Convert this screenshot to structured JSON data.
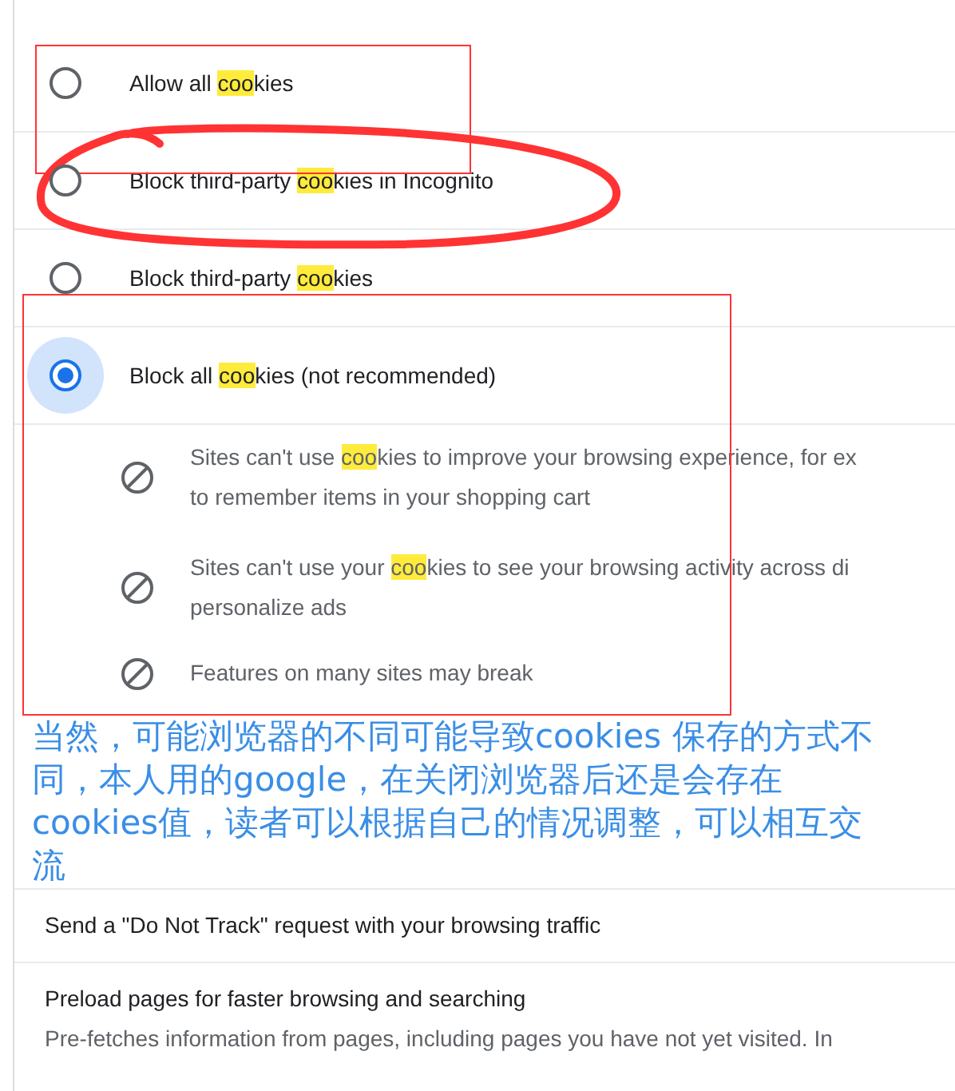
{
  "cookie_options": [
    {
      "selected": false,
      "parts": [
        {
          "text": "Allow all ",
          "highlighted": false
        },
        {
          "text": "coo",
          "highlighted": true
        },
        {
          "text": "kies",
          "highlighted": false
        }
      ]
    },
    {
      "selected": false,
      "parts": [
        {
          "text": "Block third-party ",
          "highlighted": false
        },
        {
          "text": "coo",
          "highlighted": true
        },
        {
          "text": "kies in Incognito",
          "highlighted": false
        }
      ]
    },
    {
      "selected": false,
      "parts": [
        {
          "text": "Block third-party ",
          "highlighted": false
        },
        {
          "text": "coo",
          "highlighted": true
        },
        {
          "text": "kies",
          "highlighted": false
        }
      ]
    },
    {
      "selected": true,
      "parts": [
        {
          "text": "Block all ",
          "highlighted": false
        },
        {
          "text": "coo",
          "highlighted": true
        },
        {
          "text": "kies (not recommended)",
          "highlighted": false
        }
      ]
    }
  ],
  "consequences": [
    {
      "parts": [
        {
          "text": "Sites can't use ",
          "highlighted": false
        },
        {
          "text": "coo",
          "highlighted": true
        },
        {
          "text": "kies to improve your browsing experience, for ex\nto remember items in your shopping cart",
          "highlighted": false
        }
      ]
    },
    {
      "parts": [
        {
          "text": "Sites can't use your ",
          "highlighted": false
        },
        {
          "text": "coo",
          "highlighted": true
        },
        {
          "text": "kies to see your browsing activity across di\npersonalize ads",
          "highlighted": false
        }
      ]
    },
    {
      "parts": [
        {
          "text": "Features on many sites may break",
          "highlighted": false
        }
      ]
    }
  ],
  "annotation": {
    "text": "当然，可能浏览器的不同可能导致cookies 保存的方式不同，本人用的google，在关闭浏览器后还是会存在cookies值，读者可以根据自己的情况调整，可以相互交流"
  },
  "settings": [
    {
      "title": "Send a \"Do Not Track\" request with your browsing traffic"
    },
    {
      "title": "Preload pages for faster browsing and searching",
      "description": "Pre-fetches information from pages, including pages you have not yet visited. In"
    }
  ]
}
